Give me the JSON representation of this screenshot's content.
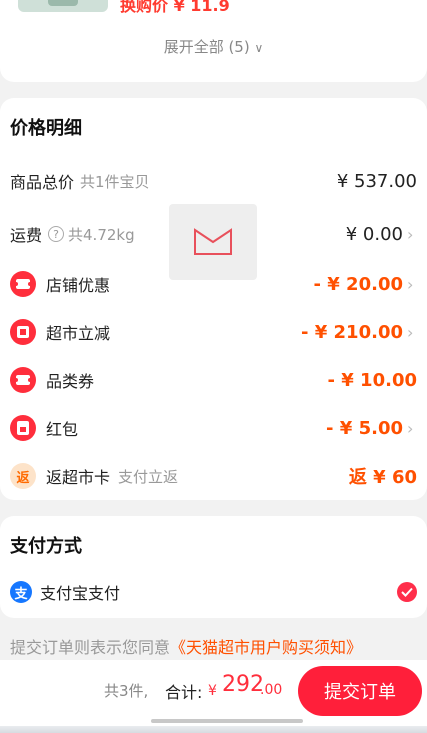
{
  "top": {
    "swap_price": "换购价 ¥ 11.9",
    "expand_all": "展开全部 (5)"
  },
  "price_detail": {
    "title": "价格明细",
    "rows": [
      {
        "label": "商品总价",
        "sub": "共1件宝贝",
        "value": "¥ 537.00"
      },
      {
        "label": "运费",
        "sub": "共4.72kg",
        "value": "¥ 0.00"
      },
      {
        "label": "店铺优惠",
        "value": "- ¥ 20.00"
      },
      {
        "label": "超市立减",
        "value": "- ¥ 210.00"
      },
      {
        "label": "品类券",
        "value": "- ¥ 10.00"
      },
      {
        "label": "红包",
        "value": "- ¥ 5.00"
      },
      {
        "label": "返超市卡",
        "sub": "支付立返",
        "value": "返 ¥ 60",
        "badge": "返"
      }
    ]
  },
  "payment": {
    "title": "支付方式",
    "method": "支付宝支付",
    "icon_char": "支"
  },
  "agreement": {
    "text": "提交订单则表示您同意",
    "link": "《天猫超市用户购买须知》"
  },
  "footer": {
    "count": "共3件,",
    "total_label": "合计:",
    "currency": "¥",
    "total_int": "292",
    "total_dec": ".00",
    "submit": "提交订单"
  },
  "colors": {
    "accent_red": "#ff1f3a",
    "discount_orange": "#ff5000",
    "alipay_blue": "#1677ff"
  }
}
